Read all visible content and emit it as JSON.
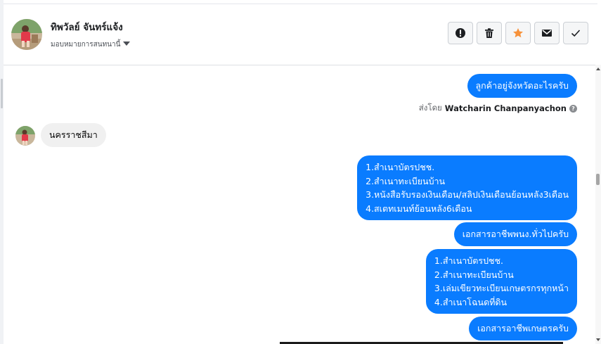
{
  "header": {
    "contact_name": "ทิพวัลย์ จันทร์แจ้ง",
    "assign_label": "มอบหมายการสนทนานี้",
    "actions": [
      {
        "icon": "alert-icon",
        "name": "mark-spam-button"
      },
      {
        "icon": "trash-icon",
        "name": "delete-button"
      },
      {
        "icon": "star-icon",
        "name": "star-button"
      },
      {
        "icon": "envelope-icon",
        "name": "mark-unread-button"
      },
      {
        "icon": "check-icon",
        "name": "mark-done-button"
      }
    ]
  },
  "messages": {
    "m1": "ลูกค้าอยู่จังหวัดอะไรครับ",
    "sent_by_label": "ส่งโดย",
    "sent_by_name": "Watcharin Chanpanyachon",
    "m2": "นครราชสีมา",
    "m3": {
      "l1": "1.สำเนาบัตรปชช.",
      "l2": "2.สำเนาทะเบียนบ้าน",
      "l3": "3.หนังสือรับรองเงินเดือน/สลิปเงินเดือนย้อนหลัง3เดือน",
      "l4": "4.สเตทเมนท์ย้อนหลัง6เดือน"
    },
    "m4": "เอกสารอาชีพพนง.ทั่วไปครับ",
    "m5": {
      "l1": "1.สำเนาบัตรปชช.",
      "l2": "2.สำเนาทะเบียนบ้าน",
      "l3": "3.เล่มเขียวทะเบียนเกษตรกรทุกหน้า",
      "l4": "4.สำเนาโฉนดที่ดิน"
    },
    "m6": "เอกสารอาชีพเกษตรครับ"
  },
  "colors": {
    "outgoing_bubble": "#0a7cff",
    "incoming_bubble": "#f0f0f0",
    "star": "#f7923b"
  }
}
